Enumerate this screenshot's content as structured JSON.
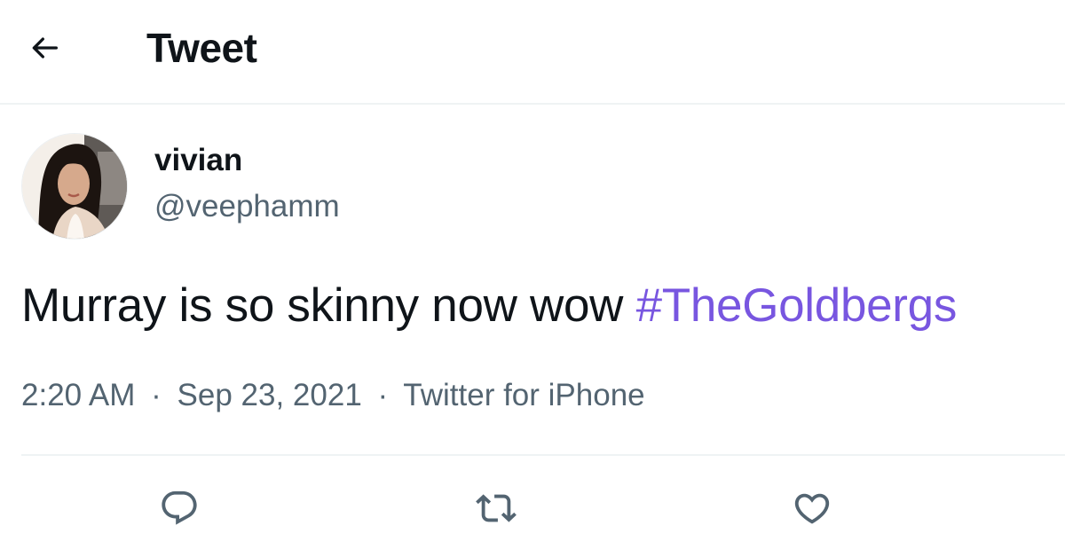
{
  "header": {
    "back_icon": "arrow-left-icon",
    "title": "Tweet"
  },
  "author": {
    "name": "vivian",
    "handle": "@veephamm"
  },
  "tweet": {
    "text": "Murray is so skinny now wow ",
    "hashtag": "#TheGoldbergs",
    "time": "2:20 AM",
    "date": "Sep 23, 2021",
    "source": "Twitter for iPhone",
    "separator": "·"
  },
  "actions": {
    "reply_icon": "reply-icon",
    "retweet_icon": "retweet-icon",
    "like_icon": "heart-icon"
  },
  "colors": {
    "text": "#0f1419",
    "secondary": "#536471",
    "hashtag": "#7856e0",
    "divider": "#eff3f4"
  }
}
